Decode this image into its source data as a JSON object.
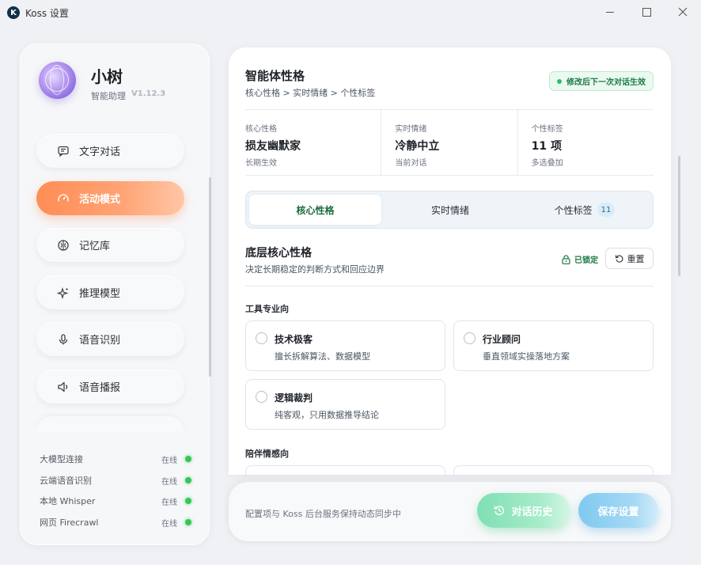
{
  "window": {
    "title": "Koss 设置",
    "icons": {
      "app": "koss-logo-icon",
      "minimize": "minimize-icon",
      "maximize": "maximize-icon",
      "close": "close-icon"
    }
  },
  "profile": {
    "name": "小树",
    "role": "智能助理",
    "version": "V1.12.3"
  },
  "nav": [
    {
      "label": "文字对话",
      "icon": "chat-icon"
    },
    {
      "label": "活动模式",
      "icon": "gauge-icon",
      "active": true
    },
    {
      "label": "记忆库",
      "icon": "brain-icon"
    },
    {
      "label": "推理模型",
      "icon": "sparkle-icon"
    },
    {
      "label": "语音识别",
      "icon": "mic-icon"
    },
    {
      "label": "语音播报",
      "icon": "speaker-icon"
    }
  ],
  "services": [
    {
      "name": "大模型连接",
      "state": "在线"
    },
    {
      "name": "云端语音识别",
      "state": "在线"
    },
    {
      "name": "本地 Whisper",
      "state": "在线"
    },
    {
      "name": "网页 Firecrawl",
      "state": "在线"
    }
  ],
  "main": {
    "title": "智能体性格",
    "breadcrumb": "核心性格 > 实时情绪 > 个性标签",
    "badge": "修改后下一次对话生效",
    "summary": [
      {
        "caption": "核心性格",
        "value": "损友幽默家",
        "sub": "长期生效"
      },
      {
        "caption": "实时情绪",
        "value": "冷静中立",
        "sub": "当前对话"
      },
      {
        "caption": "个性标签",
        "value": "11 项",
        "sub": "多选叠加"
      }
    ],
    "tabs": [
      {
        "label": "核心性格",
        "selected": true
      },
      {
        "label": "实时情绪"
      },
      {
        "label": "个性标签",
        "count": "11"
      }
    ],
    "section": {
      "title": "底层核心性格",
      "desc": "决定长期稳定的判断方式和回应边界",
      "locked": "已锁定",
      "reset": "重置"
    },
    "groups": [
      {
        "label": "工具专业向",
        "options": [
          {
            "title": "技术极客",
            "desc": "擅长拆解算法、数据模型"
          },
          {
            "title": "行业顾问",
            "desc": "垂直领域实操落地方案"
          },
          {
            "title": "逻辑裁判",
            "desc": "纯客观，只用数据推导结论"
          }
        ]
      },
      {
        "label": "陪伴情感向"
      }
    ]
  },
  "footer": {
    "text": "配置项与 Koss 后台服务保持动态同步中",
    "history": "对话历史",
    "save": "保存设置"
  },
  "colors": {
    "accent_active": "#ff8d55",
    "online": "#34c759",
    "history_btn": "#7fdfb3",
    "save_btn": "#7fc9f0",
    "tab_selected_text": "#1a6d3f"
  }
}
